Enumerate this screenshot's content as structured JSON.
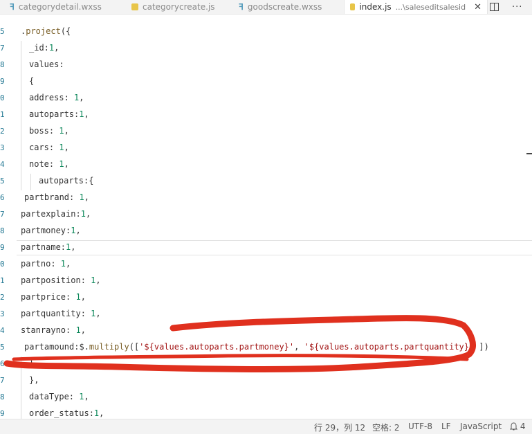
{
  "tabs": [
    {
      "label": "categorydetail.wxss",
      "icon": "css-file-icon"
    },
    {
      "label": "categorycreate.js",
      "icon": "js-file-icon"
    },
    {
      "label": "goodscreate.wxss",
      "icon": "css-file-icon"
    },
    {
      "label": "index.js",
      "hint": "...\\saleseditsalesid",
      "icon": "js-file-icon",
      "active": true
    }
  ],
  "tab_close": "✕",
  "editor": {
    "lines": [
      {
        "no": "5",
        "code": ".project({"
      },
      {
        "no": "7",
        "code": "_id:1,"
      },
      {
        "no": "8",
        "code": "values:"
      },
      {
        "no": "9",
        "code": "{"
      },
      {
        "no": "0",
        "code": "address: 1,"
      },
      {
        "no": "1",
        "code": "autoparts:1,"
      },
      {
        "no": "2",
        "code": "boss: 1,"
      },
      {
        "no": "3",
        "code": "cars: 1,"
      },
      {
        "no": "4",
        "code": "note: 1,"
      },
      {
        "no": "5",
        "code": "autoparts:{"
      },
      {
        "no": "6",
        "code": "partbrand: 1,"
      },
      {
        "no": "7",
        "code": "partexplain:1,"
      },
      {
        "no": "8",
        "code": "partmoney:1,"
      },
      {
        "no": "9",
        "code": "partname:1,"
      },
      {
        "no": "0",
        "code": "partno: 1,"
      },
      {
        "no": "1",
        "code": "partposition: 1,"
      },
      {
        "no": "2",
        "code": "partprice: 1,"
      },
      {
        "no": "3",
        "code": "partquantity: 1,"
      },
      {
        "no": "4",
        "code": "stanrayno: 1,"
      },
      {
        "no": "5",
        "code": "partamound:$.multiply(['${values.autoparts.partmoney}', '${values.autoparts.partquantity}' ])"
      },
      {
        "no": "6",
        "code": "}"
      },
      {
        "no": "7",
        "code": "},"
      },
      {
        "no": "8",
        "code": "dataType: 1,"
      },
      {
        "no": "9",
        "code": "order_status:1,"
      }
    ]
  },
  "status": {
    "position": "行 29，列 12",
    "indent": "空格: 2",
    "encoding": "UTF-8",
    "eol": "LF",
    "language": "JavaScript",
    "notifications": "4"
  },
  "colors": {
    "annotation": "#e0301e",
    "line_number": "#237893",
    "fn": "#795e26",
    "number": "#098658",
    "string": "#a31515"
  }
}
